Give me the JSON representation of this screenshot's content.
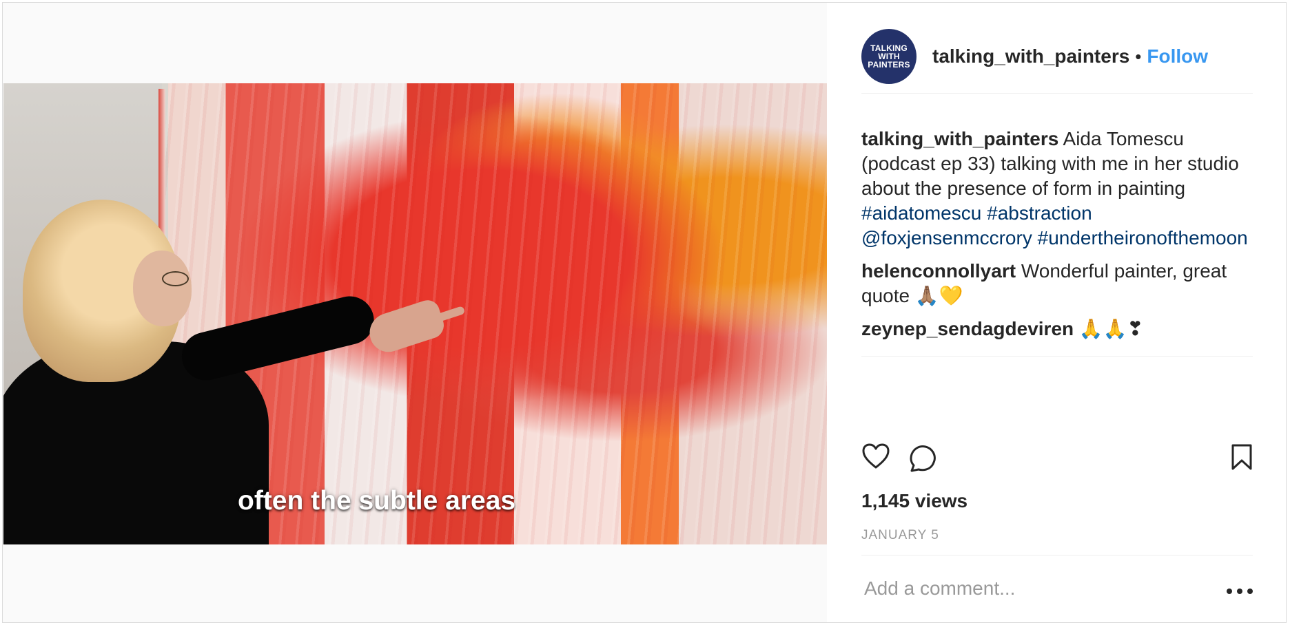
{
  "post": {
    "video": {
      "subtitle": "often the subtle areas",
      "avatar_text": "TALKING WITH PAINTERS"
    },
    "author": {
      "username": "talking_with_painters",
      "separator": "•",
      "follow_label": "Follow"
    },
    "caption": {
      "username": "talking_with_painters",
      "text_before": "Aida Tomescu (podcast ep 33) talking with me in her studio about the presence of form in painting ",
      "tag_1": "#aidatomescu",
      "tag_2": "#abstraction",
      "mention": "@foxjensenmccrory",
      "tag_3": "#undertheironofthemoon"
    },
    "comments": [
      {
        "username": "helenconnollyart",
        "text": "Wonderful painter, great quote",
        "emoji": "🙏🏽💛"
      },
      {
        "username": "zeynep_sendagdeviren",
        "emoji": "🙏🙏❣"
      }
    ],
    "stats": {
      "views": "1,145 views",
      "date": "JANUARY 5"
    },
    "comment_input": {
      "placeholder": "Add a comment..."
    }
  },
  "colors": {
    "accent": "#3897f0",
    "link": "#003569",
    "text": "#262626",
    "muted": "#999999"
  }
}
